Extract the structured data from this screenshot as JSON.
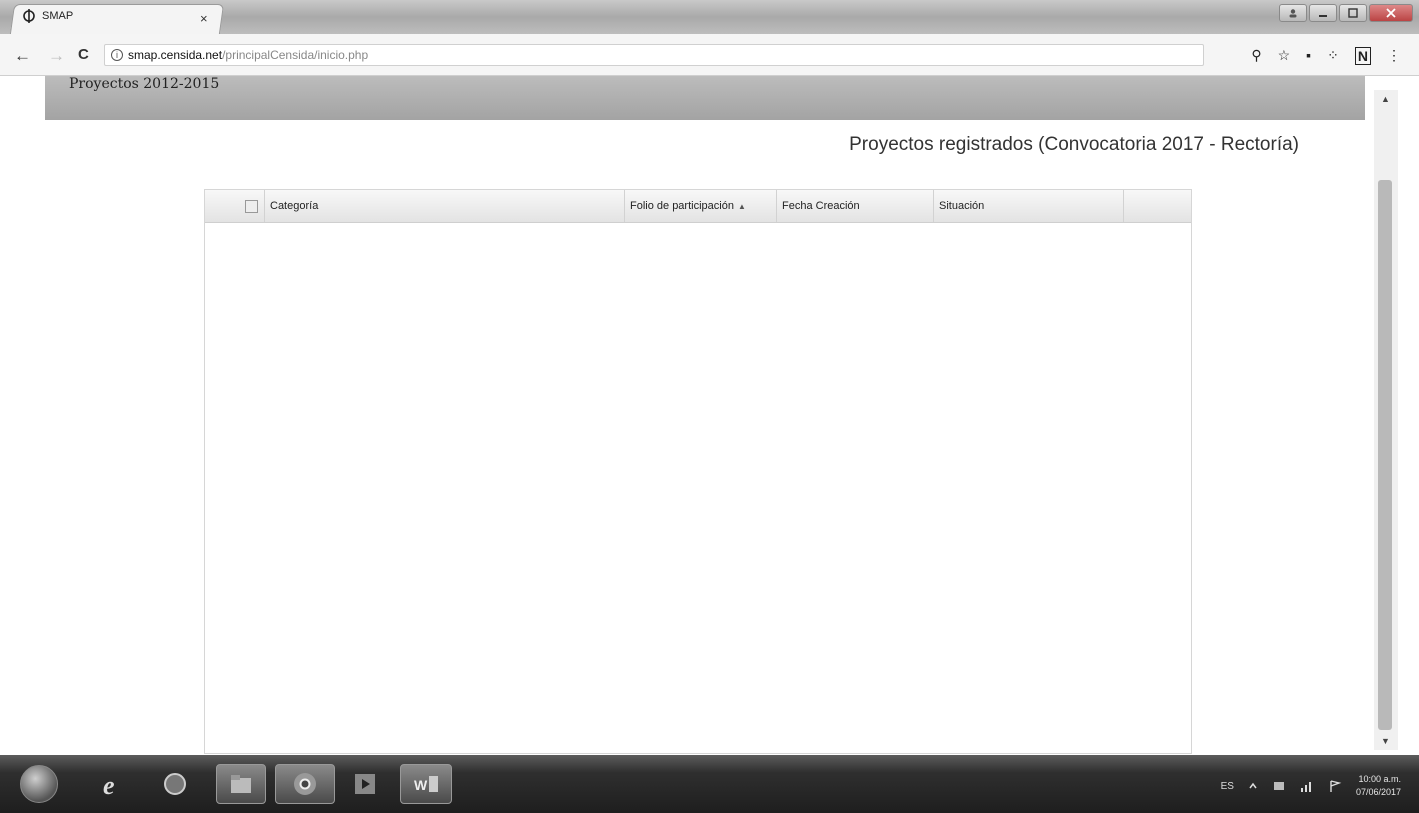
{
  "browser": {
    "tab_title": "SMAP",
    "tab_close": "×",
    "url_host": "smap.censida.net",
    "url_path": "/principalCensida/inicio.php",
    "info_glyph": "i",
    "back_glyph": "←",
    "forward_glyph": "→",
    "reload_glyph": "C",
    "extensions": [
      "key-icon",
      "star-icon",
      "pdf-icon",
      "extension-icon",
      "onenote-icon",
      "menu-icon"
    ],
    "ext_glyphs": [
      "⚲",
      "☆",
      "▪",
      "⁘",
      "N",
      "⋮"
    ]
  },
  "page": {
    "strip_label": "Proyectos 2012-2015",
    "heading": "Proyectos registrados (Convocatoria 2017 - Rectoría)"
  },
  "grid": {
    "columns": [
      "Categoría",
      "Folio de participación",
      "Fecha Creación",
      "Situación"
    ],
    "sort_indicator": "▲",
    "rows": []
  },
  "taskbar": {
    "apps": [
      "internet-explorer-icon",
      "browser-icon",
      "file-explorer-icon",
      "chrome-icon",
      "media-player-icon",
      "word-icon"
    ],
    "language": "ES",
    "time": "10:00 a.m.",
    "date": "07/06/2017"
  },
  "colors": {
    "accent": "#a9a9a9",
    "taskbar": "#1e1e1e"
  }
}
